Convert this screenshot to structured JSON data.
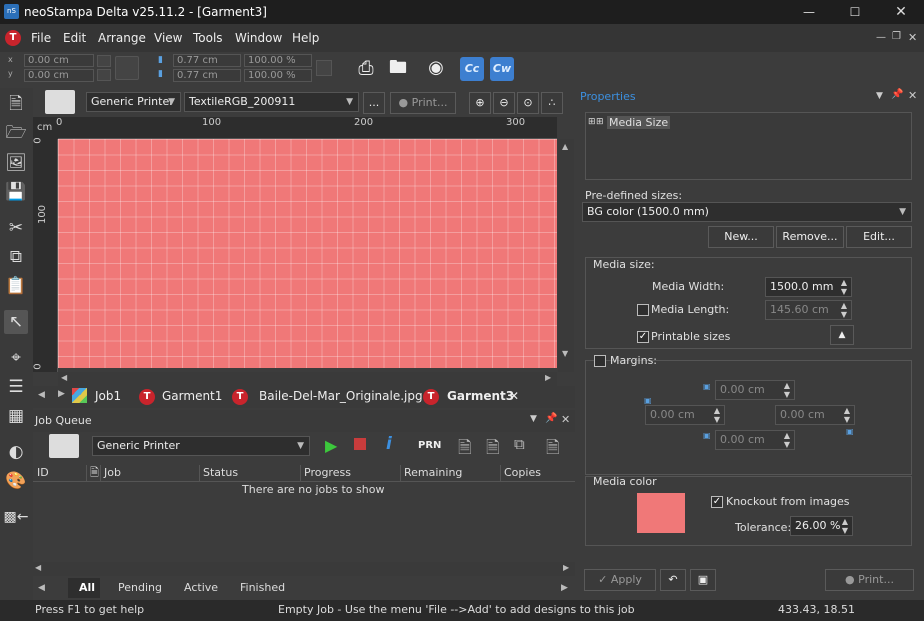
{
  "window": {
    "title": "neoStampa Delta  v25.11.2 - [Garment3]",
    "icon_text": "nS"
  },
  "menu": [
    "File",
    "Edit",
    "Arrange",
    "View",
    "Tools",
    "Window",
    "Help"
  ],
  "toolbar": {
    "x": "0.00 cm",
    "y": "0.00 cm",
    "w": "0.77 cm",
    "h": "0.77 cm",
    "sx": "100.00 %",
    "sy": "100.00 %",
    "cc": "Cc",
    "cw": "Cw"
  },
  "canvas": {
    "printer": "Generic Printer",
    "profile": "TextileRGB_200911",
    "more": "...",
    "print": "Print...",
    "ruler_unit": "cm",
    "ruler_h": [
      "0",
      "100",
      "200",
      "300"
    ],
    "ruler_v": [
      "0",
      "100",
      "0"
    ],
    "tabs": [
      "Job1",
      "Garment1",
      "Baile-Del-Mar_Originale.jpg",
      "Garment3"
    ]
  },
  "job_queue": {
    "title": "Job Queue",
    "printer": "Generic Printer",
    "prn": "PRN",
    "columns": [
      "ID",
      "",
      "Job",
      "Status",
      "Progress",
      "Remaining",
      "Copies"
    ],
    "empty": "There are no jobs to show",
    "tabs": [
      "All",
      "Pending",
      "Active",
      "Finished"
    ]
  },
  "properties": {
    "title": "Properties",
    "tree_item": "Media Size",
    "predefined_label": "Pre-defined sizes:",
    "predefined_value": "BG color (1500.0 mm)",
    "buttons": {
      "new": "New...",
      "remove": "Remove...",
      "edit": "Edit..."
    },
    "media_size_label": "Media size:",
    "media_width_label": "Media Width:",
    "media_width": "1500.0 mm",
    "media_length_label": "Media Length:",
    "media_length": "145.60 cm",
    "printable_label": "Printable sizes",
    "margins_label": "Margins:",
    "margin_top": "0.00 cm",
    "margin_left": "0.00 cm",
    "margin_right": "0.00 cm",
    "margin_bottom": "0.00 cm",
    "media_color_label": "Media color",
    "knockout_label": "Knockout from images",
    "tolerance_label": "Tolerance:",
    "tolerance": "26.00 %",
    "apply": "Apply",
    "print": "Print...",
    "media_color": "#f07878"
  },
  "status": {
    "left": "Press F1 to get help",
    "center": "Empty Job - Use the menu 'File -->Add' to add designs to this job",
    "coords": "433.43, 18.51"
  }
}
